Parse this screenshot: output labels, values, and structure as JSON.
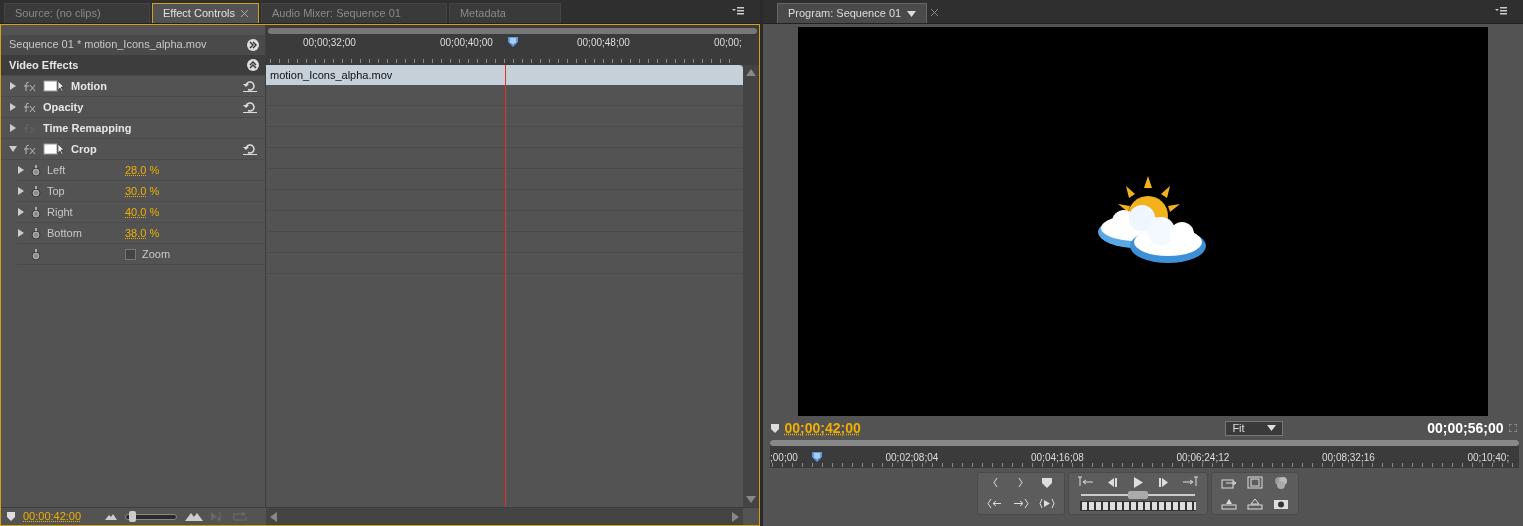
{
  "effect_controls": {
    "tabs": [
      {
        "label": "Source: (no clips)",
        "selected": false
      },
      {
        "label": "Effect Controls",
        "selected": true
      },
      {
        "label": "Audio Mixer: Sequence 01",
        "selected": false
      },
      {
        "label": "Metadata",
        "selected": false
      }
    ],
    "clip_header": "Sequence 01 * motion_Icons_alpha.mov",
    "ruler_labels": [
      "00;00;32;00",
      "00;00;40;00",
      "00;00;48;00",
      "00;00;"
    ],
    "playhead": {
      "level": 0.5
    },
    "clip_bar": "motion_Icons_alpha.mov",
    "section": "Video Effects",
    "effects": [
      {
        "name": "Motion",
        "expanded": false,
        "enabled": true,
        "motion_icon": true,
        "resettable": true
      },
      {
        "name": "Opacity",
        "expanded": false,
        "enabled": true,
        "motion_icon": false,
        "resettable": true
      },
      {
        "name": "Time Remapping",
        "expanded": false,
        "enabled": false,
        "motion_icon": false,
        "resettable": false
      },
      {
        "name": "Crop",
        "expanded": true,
        "enabled": true,
        "motion_icon": true,
        "resettable": true,
        "children": [
          {
            "kind": "value",
            "name": "Left",
            "value": "28.0",
            "unit": "%"
          },
          {
            "kind": "value",
            "name": "Top",
            "value": "30.0",
            "unit": "%"
          },
          {
            "kind": "value",
            "name": "Right",
            "value": "40.0",
            "unit": "%"
          },
          {
            "kind": "value",
            "name": "Bottom",
            "value": "38.0",
            "unit": "%"
          },
          {
            "kind": "checkbox",
            "name": "Zoom",
            "checked": false
          }
        ]
      }
    ],
    "footer_time": "00:00:42:00",
    "zoom_slider": {
      "level": 0.05
    }
  },
  "program_monitor": {
    "tab": "Program: Sequence 01",
    "current_time": "00;00;42;00",
    "fit": "Fit",
    "duration": "00;00;56;00",
    "ruler_labels": [
      ";00;00",
      "00;02;08;04",
      "00;04;16;08",
      "00;06;24;12",
      "00;08;32;16",
      "00;10;40;"
    ],
    "playhead": {
      "level": 0.063
    },
    "shuttle": {
      "level": 0.5
    }
  }
}
